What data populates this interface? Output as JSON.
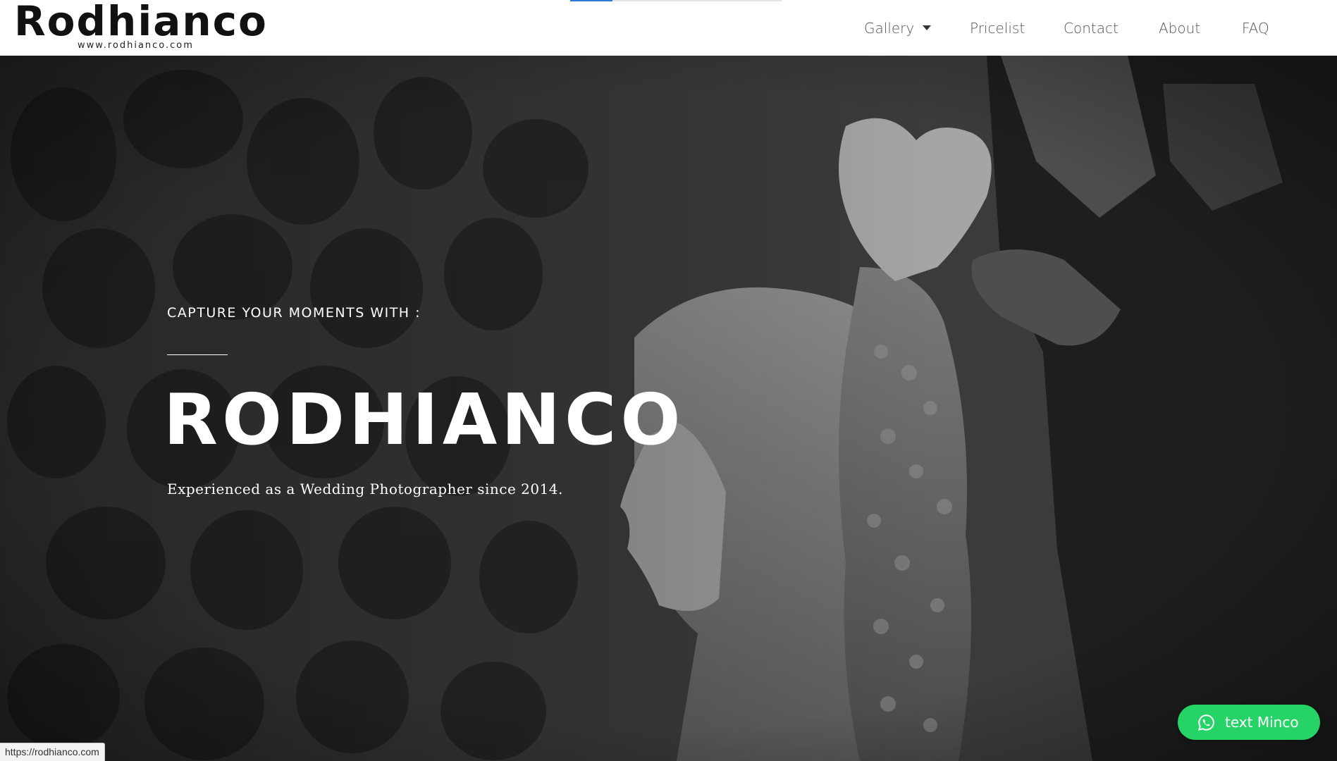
{
  "header": {
    "logo_text": "Rodhianco",
    "logo_url": "www.rodhianco.com",
    "loading_progress": 0.2,
    "nav": {
      "gallery": "Gallery",
      "pricelist": "Pricelist",
      "contact": "Contact",
      "about": "About",
      "faq": "FAQ"
    }
  },
  "hero": {
    "kicker": "CAPTURE YOUR MOMENTS WITH :",
    "title": "RODHIANCO",
    "subtitle": "Experienced as a Wedding Photographer since 2014.",
    "background": "black-and-white wedding photo"
  },
  "whatsapp": {
    "label": "text Minco",
    "icon": "whatsapp-icon",
    "color": "#25d366"
  },
  "status_bar": {
    "url": "https://rodhianco.com"
  },
  "colors": {
    "accent_loading": "#2d7bd8",
    "nav_text": "#555555",
    "hero_text": "#ffffff"
  }
}
